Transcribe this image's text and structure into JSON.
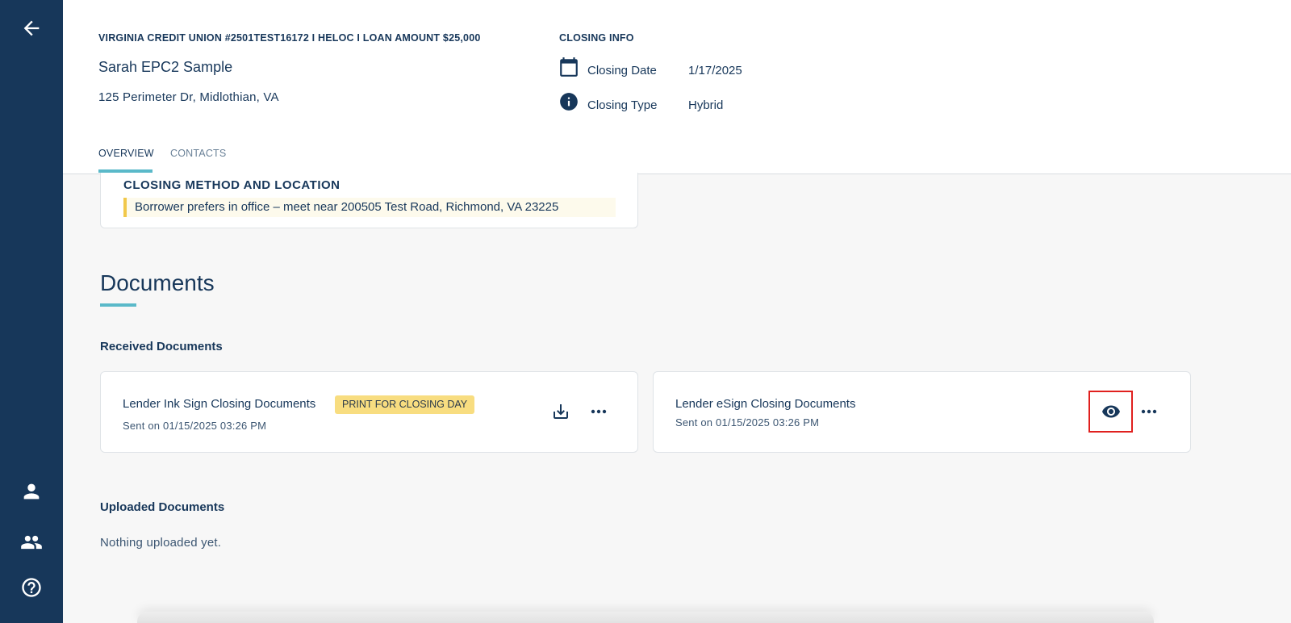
{
  "sidebar": {
    "back_icon": "arrow-left-icon",
    "items": [
      {
        "icon": "person-icon"
      },
      {
        "icon": "people-icon"
      },
      {
        "icon": "help-circle-icon"
      }
    ]
  },
  "header": {
    "loan_title": "VIRGINIA CREDIT UNION #2501TEST16172 I HELOC I LOAN AMOUNT $25,000",
    "borrower_name": "Sarah EPC2 Sample",
    "address": "125 Perimeter Dr, Midlothian, VA",
    "closing_info": {
      "heading": "CLOSING INFO",
      "date_label": "Closing Date",
      "date_value": "1/17/2025",
      "type_label": "Closing Type",
      "type_value": "Hybrid"
    },
    "tabs": [
      {
        "label": "OVERVIEW",
        "active": true
      },
      {
        "label": "CONTACTS",
        "active": false
      }
    ]
  },
  "closing_method": {
    "title": "CLOSING METHOD AND LOCATION",
    "note": "Borrower prefers in office – meet near 200505 Test Road, Richmond, VA 23225"
  },
  "documents": {
    "title": "Documents",
    "received_label": "Received Documents",
    "received": [
      {
        "name": "Lender Ink Sign Closing Documents",
        "badge": "PRINT FOR CLOSING DAY",
        "sent": "Sent on 01/15/2025 03:26 PM",
        "action_icon": "download-icon"
      },
      {
        "name": "Lender eSign Closing Documents",
        "sent": "Sent on 01/15/2025 03:26 PM",
        "action_icon": "eye-icon"
      }
    ],
    "uploaded_label": "Uploaded Documents",
    "uploaded_empty": "Nothing uploaded yet."
  },
  "colors": {
    "sidebar": "#17375a",
    "accent": "#5ab9c9",
    "badge": "#f8dd80",
    "highlight": "#e0201e"
  }
}
